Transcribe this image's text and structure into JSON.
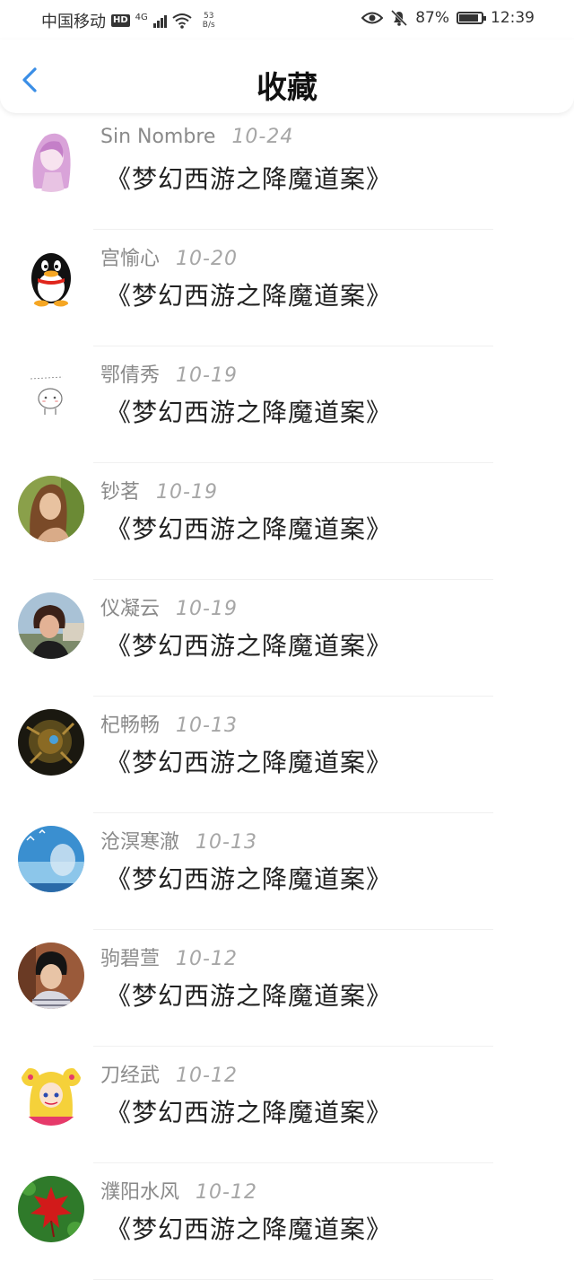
{
  "status_bar": {
    "carrier": "中国移动",
    "hd": "HD",
    "network": "4G",
    "speed_value": "53",
    "speed_unit": "B/s",
    "battery": "87%",
    "battery_level": 0.87,
    "time": "12:39"
  },
  "header": {
    "title": "收藏"
  },
  "favorites": [
    {
      "user": "Sin Nombre",
      "date": "10-24",
      "title": "《梦幻西游之降魔道案》",
      "avatar_icon": "anime-girl-avatar"
    },
    {
      "user": "宫愉心",
      "date": "10-20",
      "title": "《梦幻西游之降魔道案》",
      "avatar_icon": "penguin-avatar"
    },
    {
      "user": "鄂倩秀",
      "date": "10-19",
      "title": "《梦幻西游之降魔道案》",
      "avatar_icon": "cartoon-doodle-avatar"
    },
    {
      "user": "钞茗",
      "date": "10-19",
      "title": "《梦幻西游之降魔道案》",
      "avatar_icon": "woman-photo-avatar"
    },
    {
      "user": "仪凝云",
      "date": "10-19",
      "title": "《梦幻西游之降魔道案》",
      "avatar_icon": "person-photo-avatar"
    },
    {
      "user": "杞畅畅",
      "date": "10-13",
      "title": "《梦幻西游之降魔道案》",
      "avatar_icon": "robot-avatar"
    },
    {
      "user": "沧溟寒澈",
      "date": "10-13",
      "title": "《梦幻西游之降魔道案》",
      "avatar_icon": "sky-scene-avatar"
    },
    {
      "user": "驹碧萱",
      "date": "10-12",
      "title": "《梦幻西游之降魔道案》",
      "avatar_icon": "boy-photo-avatar"
    },
    {
      "user": "刀经武",
      "date": "10-12",
      "title": "《梦幻西游之降魔道案》",
      "avatar_icon": "sailor-moon-avatar"
    },
    {
      "user": "濮阳水风",
      "date": "10-12",
      "title": "《梦幻西游之降魔道案》",
      "avatar_icon": "maple-leaf-avatar"
    }
  ],
  "colors": {
    "accent": "#3a8ee6",
    "muted_text": "#8a8a8a",
    "title_text": "#222222"
  }
}
